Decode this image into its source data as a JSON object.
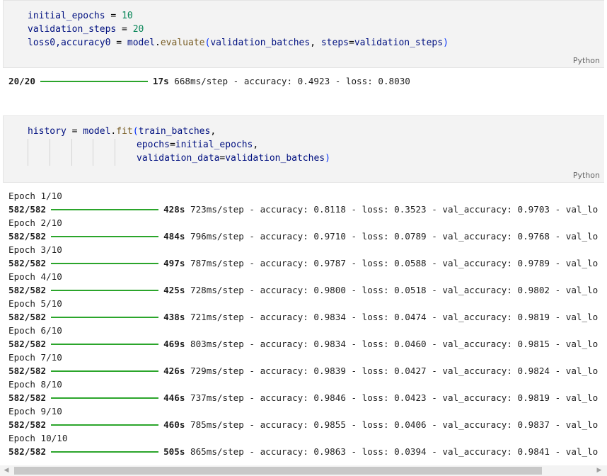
{
  "cells": [
    {
      "language": "Python",
      "lines": [
        [
          "initial_epochs",
          " = ",
          "10"
        ],
        [
          "validation_steps",
          " = ",
          "20"
        ]
      ],
      "line3": {
        "lhs": "loss0,accuracy0",
        "eq": " = ",
        "obj": "model",
        "dot": ".",
        "fn": "evaluate",
        "open": "(",
        "arg1": "validation_batches",
        "sep": ", ",
        "kwname": "steps",
        "kweq": "=",
        "kwval": "validation_steps",
        "close": ")"
      },
      "output": {
        "progress": "20/20",
        "time": "17s",
        "rest": "668ms/step - accuracy: 0.4923 - loss: 0.8030"
      }
    },
    {
      "language": "Python",
      "l1": {
        "lhs": "history",
        "eq": " = ",
        "obj": "model",
        "dot": ".",
        "fn": "fit",
        "open": "(",
        "arg": "train_batches",
        "comma": ","
      },
      "l2": {
        "name": "epochs",
        "eq": "=",
        "val": "initial_epochs",
        "comma": ","
      },
      "l3": {
        "name": "validation_data",
        "eq": "=",
        "val": "validation_batches",
        "close": ")"
      }
    }
  ],
  "epochs": [
    {
      "label": "Epoch 1/10",
      "progress": "582/582",
      "time": "428s",
      "rest": "723ms/step - accuracy: 0.8118 - loss: 0.3523 - val_accuracy: 0.9703 - val_lo"
    },
    {
      "label": "Epoch 2/10",
      "progress": "582/582",
      "time": "484s",
      "rest": "796ms/step - accuracy: 0.9710 - loss: 0.0789 - val_accuracy: 0.9768 - val_lo"
    },
    {
      "label": "Epoch 3/10",
      "progress": "582/582",
      "time": "497s",
      "rest": "787ms/step - accuracy: 0.9787 - loss: 0.0588 - val_accuracy: 0.9789 - val_lo"
    },
    {
      "label": "Epoch 4/10",
      "progress": "582/582",
      "time": "425s",
      "rest": "728ms/step - accuracy: 0.9800 - loss: 0.0518 - val_accuracy: 0.9802 - val_lo"
    },
    {
      "label": "Epoch 5/10",
      "progress": "582/582",
      "time": "438s",
      "rest": "721ms/step - accuracy: 0.9834 - loss: 0.0474 - val_accuracy: 0.9819 - val_lo"
    },
    {
      "label": "Epoch 6/10",
      "progress": "582/582",
      "time": "469s",
      "rest": "803ms/step - accuracy: 0.9834 - loss: 0.0460 - val_accuracy: 0.9815 - val_lo"
    },
    {
      "label": "Epoch 7/10",
      "progress": "582/582",
      "time": "426s",
      "rest": "729ms/step - accuracy: 0.9839 - loss: 0.0427 - val_accuracy: 0.9824 - val_lo"
    },
    {
      "label": "Epoch 8/10",
      "progress": "582/582",
      "time": "446s",
      "rest": "737ms/step - accuracy: 0.9846 - loss: 0.0423 - val_accuracy: 0.9819 - val_lo"
    },
    {
      "label": "Epoch 9/10",
      "progress": "582/582",
      "time": "460s",
      "rest": "785ms/step - accuracy: 0.9855 - loss: 0.0406 - val_accuracy: 0.9837 - val_lo"
    },
    {
      "label": "Epoch 10/10",
      "progress": "582/582",
      "time": "505s",
      "rest": "865ms/step - accuracy: 0.9863 - loss: 0.0394 - val_accuracy: 0.9841 - val_lo"
    }
  ],
  "colors": {
    "progress_bar": "#2ba52b",
    "cell_background": "#f3f3f3"
  },
  "scrollbar": {
    "left_arrow": "◀",
    "right_arrow": "▶"
  }
}
